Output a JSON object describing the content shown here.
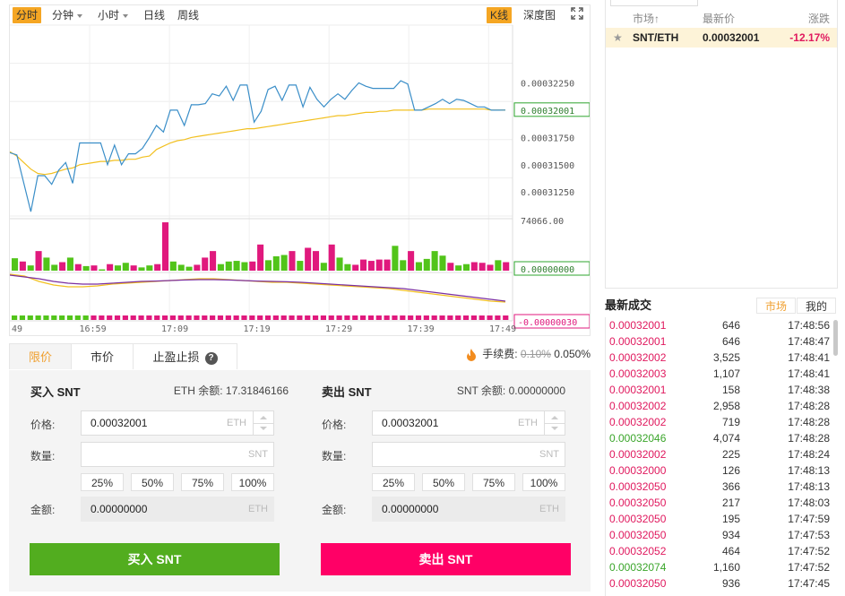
{
  "chart_toolbar": {
    "timeshare": "分时",
    "minute": "分钟",
    "hour": "小时",
    "day": "日线",
    "week": "周线",
    "kline": "K线",
    "depth": "深度图",
    "fullscreen_icon": "expand-icon"
  },
  "chart_data": {
    "type": "line",
    "x_ticks": [
      "49",
      "16:59",
      "17:09",
      "17:19",
      "17:29",
      "17:39",
      "17:49"
    ],
    "price_axis": {
      "ticks": [
        0.0003225,
        0.0003175,
        0.000315,
        0.0003125
      ],
      "tick_labels": [
        "0.00032250",
        "0.00031750",
        "0.00031500",
        "0.00031250"
      ],
      "current_label": "0.00032001",
      "range": [
        0.0003103,
        0.0003278
      ]
    },
    "price_series": [
      0.0003161,
      0.0003159,
      0.0003133,
      0.0003107,
      0.000314,
      0.000314,
      0.0003132,
      0.0003145,
      0.0003152,
      0.0003133,
      0.000317,
      0.000317,
      0.000317,
      0.000317,
      0.000315,
      0.0003168,
      0.000315,
      0.000316,
      0.000316,
      0.0003165,
      0.0003175,
      0.0003186,
      0.000318,
      0.00032,
      0.00032,
      0.0003186,
      0.0003205,
      0.0003205,
      0.0003206,
      0.0003215,
      0.0003213,
      0.0003222,
      0.0003209,
      0.0003223,
      0.0003223,
      0.0003189,
      0.0003199,
      0.0003219,
      0.0003222,
      0.0003209,
      0.0003223,
      0.0003223,
      0.0003203,
      0.0003221,
      0.000321,
      0.0003203,
      0.000321,
      0.0003215,
      0.000321,
      0.0003218,
      0.0003225,
      0.0003222,
      0.000322,
      0.000322,
      0.000322,
      0.000322,
      0.0003227,
      0.0003224,
      0.00032,
      0.00032,
      0.0003203,
      0.0003206,
      0.000321,
      0.0003206,
      0.000321,
      0.0003209,
      0.0003206,
      0.0003203,
      0.0003203,
      0.00032,
      0.00032,
      0.00032001
    ],
    "ma_series": [
      0.0003162,
      0.0003158,
      0.0003152,
      0.0003146,
      0.0003142,
      0.0003141,
      0.0003142,
      0.0003144,
      0.0003146,
      0.0003147,
      0.000315,
      0.0003151,
      0.0003152,
      0.0003153,
      0.0003153,
      0.0003154,
      0.0003154,
      0.0003155,
      0.0003155,
      0.0003157,
      0.0003158,
      0.0003164,
      0.0003167,
      0.000317,
      0.0003172,
      0.0003173,
      0.0003175,
      0.0003176,
      0.0003177,
      0.0003178,
      0.0003179,
      0.000318,
      0.0003181,
      0.0003182,
      0.0003183,
      0.0003183,
      0.0003184,
      0.0003185,
      0.0003186,
      0.0003187,
      0.0003188,
      0.0003189,
      0.000319,
      0.0003191,
      0.0003192,
      0.0003193,
      0.0003194,
      0.0003195,
      0.0003195,
      0.0003196,
      0.0003197,
      0.0003198,
      0.0003198,
      0.0003199,
      0.0003199,
      0.00032,
      0.00032,
      0.00032,
      0.00032,
      0.00032,
      0.0003201,
      0.0003201,
      0.0003201,
      0.0003201,
      0.0003201,
      0.0003201,
      0.0003201,
      0.0003201,
      0.0003201,
      0.00032,
      0.00032,
      0.00032
    ],
    "volume_axis": {
      "top_label": "74066.00",
      "current_label": "0.00000000",
      "max": 74066
    },
    "volumes": [
      19000,
      14000,
      8000,
      30000,
      20000,
      9000,
      13000,
      20000,
      10000,
      7000,
      8000,
      2000,
      10000,
      8000,
      12000,
      8000,
      5000,
      8000,
      10000,
      74000,
      14000,
      9000,
      6000,
      9000,
      20000,
      30000,
      10000,
      14000,
      15000,
      13000,
      14000,
      40000,
      16000,
      22000,
      24000,
      30000,
      15000,
      35000,
      30000,
      12000,
      40000,
      20000,
      10000,
      9000,
      17000,
      15000,
      17000,
      17000,
      38000,
      16000,
      30000,
      13000,
      18000,
      30000,
      23000,
      12000,
      8000,
      10000,
      13000,
      12000,
      9000,
      16000,
      13000
    ],
    "volume_colors": [
      "up",
      "down",
      "up",
      "down",
      "up",
      "up",
      "down",
      "up",
      "down",
      "up",
      "down",
      "up",
      "down",
      "up",
      "up",
      "down",
      "up",
      "up",
      "down",
      "down",
      "up",
      "up",
      "up",
      "down",
      "down",
      "down",
      "up",
      "up",
      "up",
      "up",
      "down",
      "down",
      "up",
      "up",
      "up",
      "down",
      "up",
      "down",
      "down",
      "up",
      "down",
      "up",
      "up",
      "down",
      "down",
      "down",
      "down",
      "down",
      "up",
      "up",
      "down",
      "up",
      "up",
      "up",
      "up",
      "down",
      "up",
      "up",
      "down",
      "down",
      "down",
      "up",
      "down"
    ],
    "macd_axis": {
      "current_label": "-0.00000030"
    },
    "macd_line1": [
      0.6,
      0.5,
      0.2,
      0.0,
      -0.1,
      -0.1,
      -0.05,
      0.05,
      0.1,
      0.15,
      0.2,
      0.25,
      0.3,
      0.35,
      0.35,
      0.3,
      0.25,
      0.2,
      0.15,
      0.15,
      0.1,
      0.05,
      0.0,
      -0.05,
      -0.1,
      -0.15,
      -0.2,
      -0.3,
      -0.4,
      -0.5,
      -0.6,
      -0.7,
      -0.8,
      -0.9,
      -0.95
    ],
    "macd_line2": [
      0.55,
      0.45,
      0.35,
      0.2,
      0.1,
      0.05,
      0.05,
      0.1,
      0.15,
      0.2,
      0.22,
      0.25,
      0.28,
      0.3,
      0.3,
      0.28,
      0.25,
      0.22,
      0.2,
      0.18,
      0.15,
      0.1,
      0.05,
      0.0,
      -0.05,
      -0.1,
      -0.15,
      -0.2,
      -0.3,
      -0.4,
      -0.5,
      -0.6,
      -0.7,
      -0.8,
      -0.9
    ],
    "macd_hist": [
      -0.3,
      -0.3,
      -0.3,
      -0.3,
      -0.3,
      -0.3,
      -0.3,
      -0.3,
      -0.3,
      -0.3,
      -0.3,
      -0.3,
      -0.3,
      -0.3,
      -0.3,
      -0.3,
      -0.3,
      -0.3,
      -0.3,
      -0.3,
      -0.3,
      -0.3,
      -0.3,
      -0.3,
      -0.3,
      -0.3,
      -0.3,
      -0.3,
      -0.3,
      -0.3,
      -0.3,
      -0.3,
      -0.3,
      -0.3,
      -0.3,
      -0.3,
      -0.3,
      -0.3,
      -0.3,
      -0.3,
      -0.3,
      -0.3,
      -0.3,
      -0.3,
      -0.3,
      -0.3,
      -0.3,
      -0.3,
      -0.3,
      -0.3,
      -0.3,
      -0.3,
      -0.3,
      -0.3,
      -0.3,
      -0.3,
      -0.3,
      -0.3,
      -0.3,
      -0.3,
      -0.3,
      -0.3,
      -0.3
    ],
    "colors": {
      "price": "#3a8ec8",
      "ma": "#f2c020",
      "up": "#52c41a",
      "down": "#e0197d",
      "macd1": "#f2c020",
      "macd2": "#7b2fa0"
    }
  },
  "order_tabs": {
    "limit": "限价",
    "market": "市价",
    "stop": "止盈止损",
    "help_icon": "?"
  },
  "fee": {
    "label": "手续费:",
    "old": "0.10%",
    "new": "0.050%"
  },
  "buy": {
    "title": "买入 SNT",
    "balance": "ETH 余额: 17.31846166",
    "price_label": "价格:",
    "price_value": "0.00032001",
    "price_unit": "ETH",
    "qty_label": "数量:",
    "qty_unit": "SNT",
    "pcts": [
      "25%",
      "50%",
      "75%",
      "100%"
    ],
    "amount_label": "金额:",
    "amount_value": "0.00000000",
    "amount_unit": "ETH",
    "button": "买入 SNT"
  },
  "sell": {
    "title": "卖出 SNT",
    "balance": "SNT 余额: 0.00000000",
    "price_label": "价格:",
    "price_value": "0.00032001",
    "price_unit": "ETH",
    "qty_label": "数量:",
    "qty_unit": "SNT",
    "pcts": [
      "25%",
      "50%",
      "75%",
      "100%"
    ],
    "amount_label": "金额:",
    "amount_value": "0.00000000",
    "amount_unit": "ETH",
    "button": "卖出 SNT"
  },
  "market": {
    "col_market": "市场↑",
    "col_price": "最新价",
    "col_change": "涨跌",
    "row": {
      "pair": "SNT/ETH",
      "price": "0.00032001",
      "change": "-12.17%"
    }
  },
  "trades": {
    "title": "最新成交",
    "tab_market": "市场",
    "tab_mine": "我的",
    "rows": [
      {
        "price": "0.00032001",
        "qty": "646",
        "time": "17:48:56",
        "side": "down"
      },
      {
        "price": "0.00032001",
        "qty": "646",
        "time": "17:48:47",
        "side": "down"
      },
      {
        "price": "0.00032002",
        "qty": "3,525",
        "time": "17:48:41",
        "side": "down"
      },
      {
        "price": "0.00032003",
        "qty": "1,107",
        "time": "17:48:41",
        "side": "down"
      },
      {
        "price": "0.00032001",
        "qty": "158",
        "time": "17:48:38",
        "side": "down"
      },
      {
        "price": "0.00032002",
        "qty": "2,958",
        "time": "17:48:28",
        "side": "down"
      },
      {
        "price": "0.00032002",
        "qty": "719",
        "time": "17:48:28",
        "side": "down"
      },
      {
        "price": "0.00032046",
        "qty": "4,074",
        "time": "17:48:28",
        "side": "up"
      },
      {
        "price": "0.00032002",
        "qty": "225",
        "time": "17:48:24",
        "side": "down"
      },
      {
        "price": "0.00032000",
        "qty": "126",
        "time": "17:48:13",
        "side": "down"
      },
      {
        "price": "0.00032050",
        "qty": "366",
        "time": "17:48:13",
        "side": "down"
      },
      {
        "price": "0.00032050",
        "qty": "217",
        "time": "17:48:03",
        "side": "down"
      },
      {
        "price": "0.00032050",
        "qty": "195",
        "time": "17:47:59",
        "side": "down"
      },
      {
        "price": "0.00032050",
        "qty": "934",
        "time": "17:47:53",
        "side": "down"
      },
      {
        "price": "0.00032052",
        "qty": "464",
        "time": "17:47:52",
        "side": "down"
      },
      {
        "price": "0.00032074",
        "qty": "1,160",
        "time": "17:47:52",
        "side": "up"
      },
      {
        "price": "0.00032050",
        "qty": "936",
        "time": "17:47:45",
        "side": "down"
      }
    ]
  },
  "colors": {
    "accent": "#f5a623",
    "buy": "#52ad1f",
    "sell": "#ff0066",
    "up": "#3aa52a",
    "down": "#e0195e",
    "change_neg": "#e0195e"
  }
}
